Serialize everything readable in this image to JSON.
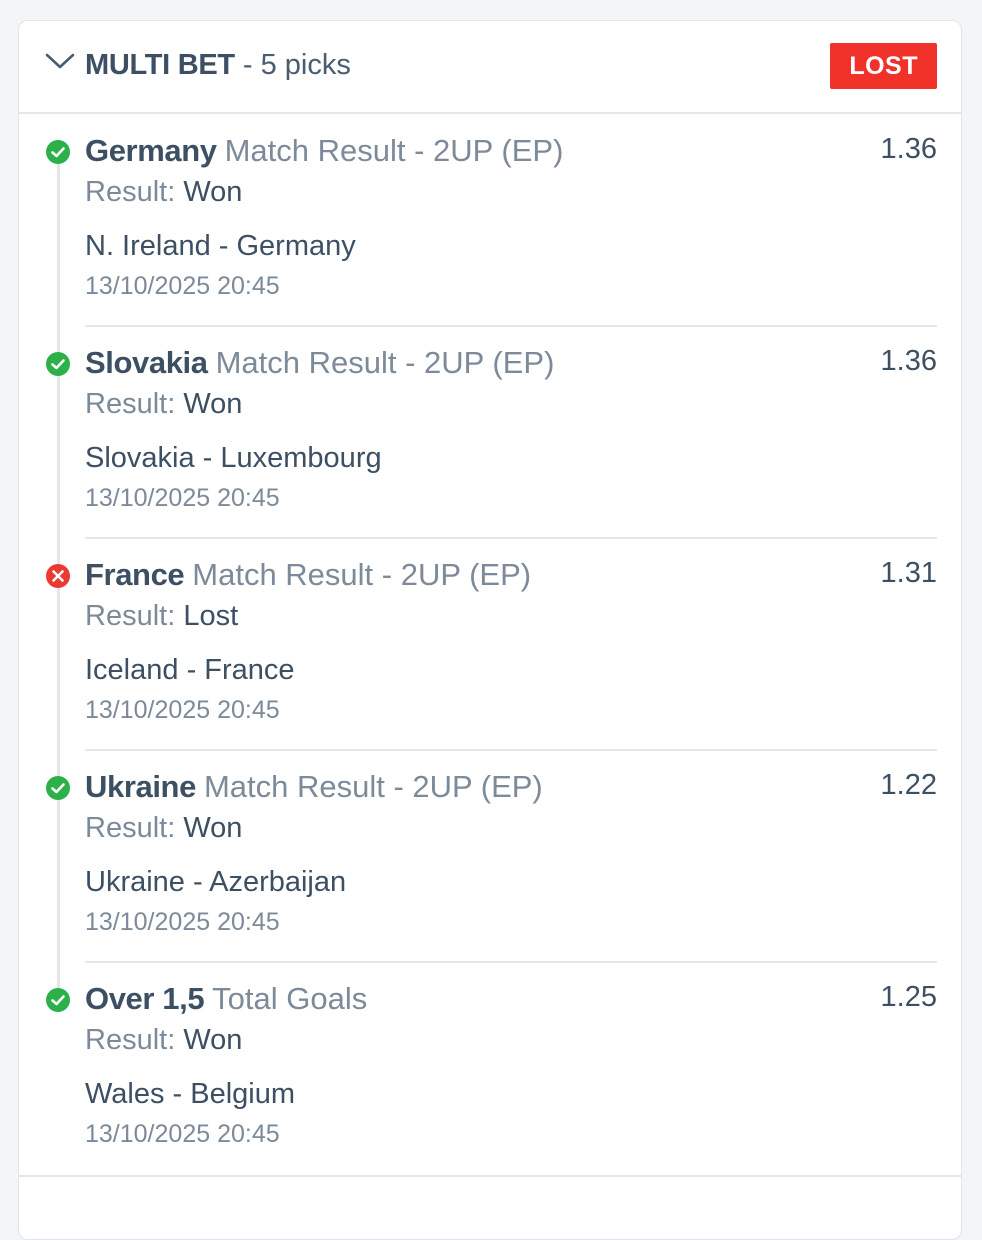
{
  "bet": {
    "type_label": "MULTI BET",
    "picks_label": " - 5 picks",
    "status_badge": "LOST",
    "status_color": "#f0322a"
  },
  "legs": [
    {
      "status": "won",
      "selection": "Germany",
      "market": "Match Result - 2UP (EP)",
      "odds": "1.36",
      "result_label": "Result:",
      "result_value": "Won",
      "event": "N. Ireland - Germany",
      "datetime": "13/10/2025 20:45"
    },
    {
      "status": "won",
      "selection": "Slovakia",
      "market": "Match Result - 2UP (EP)",
      "odds": "1.36",
      "result_label": "Result:",
      "result_value": "Won",
      "event": "Slovakia - Luxembourg",
      "datetime": "13/10/2025 20:45"
    },
    {
      "status": "lost",
      "selection": "France",
      "market": "Match Result - 2UP (EP)",
      "odds": "1.31",
      "result_label": "Result:",
      "result_value": "Lost",
      "event": "Iceland - France",
      "datetime": "13/10/2025 20:45"
    },
    {
      "status": "won",
      "selection": "Ukraine",
      "market": "Match Result - 2UP (EP)",
      "odds": "1.22",
      "result_label": "Result:",
      "result_value": "Won",
      "event": "Ukraine - Azerbaijan",
      "datetime": "13/10/2025 20:45"
    },
    {
      "status": "won",
      "selection": "Over 1,5",
      "market": "Total Goals",
      "odds": "1.25",
      "result_label": "Result:",
      "result_value": "Won",
      "event": "Wales - Belgium",
      "datetime": "13/10/2025 20:45"
    }
  ],
  "colors": {
    "won": "#2bb04a",
    "lost": "#ea3b32"
  }
}
